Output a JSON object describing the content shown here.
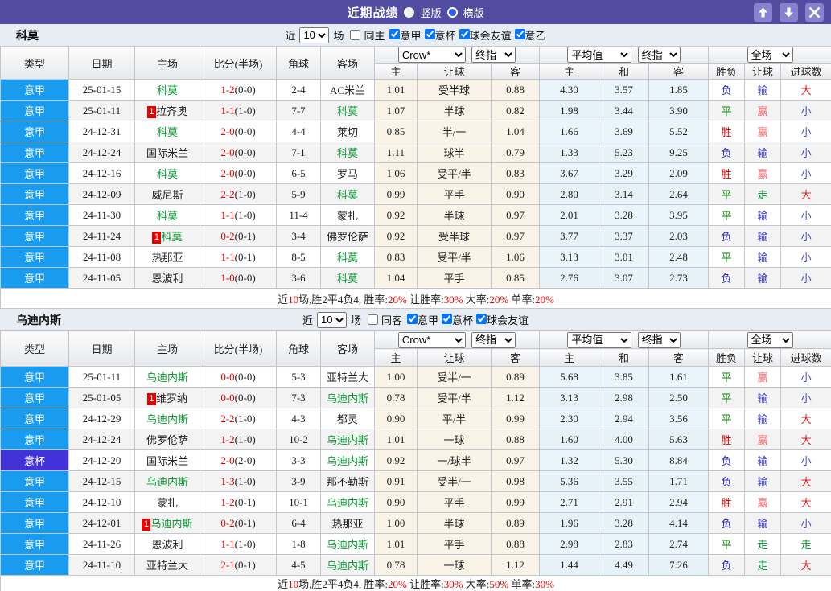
{
  "titlebar": {
    "title": "近期战绩",
    "layout_options": [
      {
        "label": "竖版",
        "selected": false
      },
      {
        "label": "横版",
        "selected": true
      }
    ],
    "button_icons": [
      "up-arrow-icon",
      "down-arrow-icon",
      "close-icon"
    ]
  },
  "colors": {
    "league_type": "#199CF0",
    "cup_type": "#4133D8",
    "team_green": "#0a9a32",
    "score_red": "#e60000",
    "titlebar_purple": "#524CA1",
    "value_colors": {
      "胜": "#d40000",
      "平": "#008000",
      "负": "#2626c9",
      "赢": "#f66666",
      "输": "#3535c9",
      "走": "#009030",
      "大": "#e22222",
      "小": "#4d4dde"
    }
  },
  "table_headers": {
    "base": [
      "类型",
      "日期",
      "主场",
      "比分(半场)",
      "角球",
      "客场"
    ],
    "sub": [
      "主",
      "让球",
      "客",
      "主",
      "和",
      "客",
      "胜负",
      "让球",
      "进球数"
    ]
  },
  "sections": [
    {
      "team": "科莫",
      "filter": {
        "recent": "近",
        "count": "10",
        "games": "场",
        "same": "同主",
        "same_checked": false,
        "leagues": [
          {
            "label": "意甲",
            "checked": true
          },
          {
            "label": "意杯",
            "checked": true
          },
          {
            "label": "球会友谊",
            "checked": true
          },
          {
            "label": "意乙",
            "checked": true
          }
        ]
      },
      "dropdowns": [
        "Crow*",
        "终指",
        "平均值",
        "终指",
        "全场"
      ],
      "rows": [
        {
          "type": "意甲",
          "cup": false,
          "date": "25-01-15",
          "home": "科莫",
          "home_green": true,
          "badge": "",
          "ft": "1-2",
          "ht": "(0-0)",
          "corner": "2-4",
          "away": "AC米兰",
          "away_green": false,
          "o1": "1.01",
          "o2": "受半球",
          "o3": "0.88",
          "a1": "4.30",
          "a2": "3.57",
          "a3": "1.85",
          "res": "负",
          "han": "输",
          "goal": "大"
        },
        {
          "type": "意甲",
          "cup": false,
          "date": "25-01-11",
          "home": "拉齐奥",
          "home_green": false,
          "badge": "1",
          "ft": "1-1",
          "ht": "(1-0)",
          "corner": "7-7",
          "away": "科莫",
          "away_green": true,
          "o1": "1.07",
          "o2": "半球",
          "o3": "0.82",
          "a1": "1.98",
          "a2": "3.44",
          "a3": "3.90",
          "res": "平",
          "han": "赢",
          "goal": "小"
        },
        {
          "type": "意甲",
          "cup": false,
          "date": "24-12-31",
          "home": "科莫",
          "home_green": true,
          "badge": "",
          "ft": "2-0",
          "ht": "(0-0)",
          "corner": "4-4",
          "away": "莱切",
          "away_green": false,
          "o1": "0.85",
          "o2": "半/一",
          "o3": "1.04",
          "a1": "1.66",
          "a2": "3.69",
          "a3": "5.52",
          "res": "胜",
          "han": "赢",
          "goal": "小"
        },
        {
          "type": "意甲",
          "cup": false,
          "date": "24-12-24",
          "home": "国际米兰",
          "home_green": false,
          "badge": "",
          "ft": "2-0",
          "ht": "(0-0)",
          "corner": "7-1",
          "away": "科莫",
          "away_green": true,
          "o1": "1.11",
          "o2": "球半",
          "o3": "0.79",
          "a1": "1.33",
          "a2": "5.23",
          "a3": "9.25",
          "res": "负",
          "han": "输",
          "goal": "小"
        },
        {
          "type": "意甲",
          "cup": false,
          "date": "24-12-16",
          "home": "科莫",
          "home_green": true,
          "badge": "",
          "ft": "2-0",
          "ht": "(0-0)",
          "corner": "6-5",
          "away": "罗马",
          "away_green": false,
          "o1": "1.06",
          "o2": "受平/半",
          "o3": "0.83",
          "a1": "3.67",
          "a2": "3.29",
          "a3": "2.09",
          "res": "胜",
          "han": "赢",
          "goal": "小"
        },
        {
          "type": "意甲",
          "cup": false,
          "date": "24-12-09",
          "home": "威尼斯",
          "home_green": false,
          "badge": "",
          "ft": "2-2",
          "ht": "(1-0)",
          "corner": "5-9",
          "away": "科莫",
          "away_green": true,
          "o1": "0.99",
          "o2": "平手",
          "o3": "0.90",
          "a1": "2.80",
          "a2": "3.14",
          "a3": "2.64",
          "res": "平",
          "han": "走",
          "goal": "大"
        },
        {
          "type": "意甲",
          "cup": false,
          "date": "24-11-30",
          "home": "科莫",
          "home_green": true,
          "badge": "",
          "ft": "1-1",
          "ht": "(1-0)",
          "corner": "11-4",
          "away": "蒙扎",
          "away_green": false,
          "o1": "0.92",
          "o2": "半球",
          "o3": "0.97",
          "a1": "2.01",
          "a2": "3.28",
          "a3": "3.95",
          "res": "平",
          "han": "输",
          "goal": "小"
        },
        {
          "type": "意甲",
          "cup": false,
          "date": "24-11-24",
          "home": "科莫",
          "home_green": true,
          "badge": "1",
          "ft": "0-2",
          "ht": "(0-1)",
          "corner": "3-4",
          "away": "佛罗伦萨",
          "away_green": false,
          "o1": "0.92",
          "o2": "受半球",
          "o3": "0.97",
          "a1": "3.77",
          "a2": "3.37",
          "a3": "2.03",
          "res": "负",
          "han": "输",
          "goal": "小"
        },
        {
          "type": "意甲",
          "cup": false,
          "date": "24-11-08",
          "home": "热那亚",
          "home_green": false,
          "badge": "",
          "ft": "1-1",
          "ht": "(0-1)",
          "corner": "8-5",
          "away": "科莫",
          "away_green": true,
          "o1": "0.83",
          "o2": "受平/半",
          "o3": "1.06",
          "a1": "3.13",
          "a2": "3.01",
          "a3": "2.48",
          "res": "平",
          "han": "输",
          "goal": "小"
        },
        {
          "type": "意甲",
          "cup": false,
          "date": "24-11-05",
          "home": "恩波利",
          "home_green": false,
          "badge": "",
          "ft": "1-0",
          "ht": "(0-0)",
          "corner": "3-6",
          "away": "科莫",
          "away_green": true,
          "o1": "1.04",
          "o2": "平手",
          "o3": "0.85",
          "a1": "2.76",
          "a2": "3.07",
          "a3": "2.73",
          "res": "负",
          "han": "输",
          "goal": "小"
        }
      ],
      "summary": [
        {
          "text": "近",
          "red": false
        },
        {
          "text": "10",
          "red": true
        },
        {
          "text": "场,胜2平4负4, 胜率:",
          "red": false
        },
        {
          "text": "20%",
          "red": true
        },
        {
          "text": " 让胜率:",
          "red": false
        },
        {
          "text": "30%",
          "red": true
        },
        {
          "text": " 大率:",
          "red": false
        },
        {
          "text": "20%",
          "red": true
        },
        {
          "text": " 单率:",
          "red": false
        },
        {
          "text": "20%",
          "red": true
        }
      ]
    },
    {
      "team": "乌迪内斯",
      "filter": {
        "recent": "近",
        "count": "10",
        "games": "场",
        "same": "同客",
        "same_checked": false,
        "leagues": [
          {
            "label": "意甲",
            "checked": true
          },
          {
            "label": "意杯",
            "checked": true
          },
          {
            "label": "球会友谊",
            "checked": true
          }
        ]
      },
      "dropdowns": [
        "Crow*",
        "终指",
        "平均值",
        "终指",
        "全场"
      ],
      "rows": [
        {
          "type": "意甲",
          "cup": false,
          "date": "25-01-11",
          "home": "乌迪内斯",
          "home_green": true,
          "badge": "",
          "ft": "0-0",
          "ht": "(0-0)",
          "corner": "5-3",
          "away": "亚特兰大",
          "away_green": false,
          "o1": "1.00",
          "o2": "受半/一",
          "o3": "0.89",
          "a1": "5.68",
          "a2": "3.85",
          "a3": "1.61",
          "res": "平",
          "han": "赢",
          "goal": "小"
        },
        {
          "type": "意甲",
          "cup": false,
          "date": "25-01-05",
          "home": "维罗纳",
          "home_green": false,
          "badge": "1",
          "ft": "0-0",
          "ht": "(0-0)",
          "corner": "7-3",
          "away": "乌迪内斯",
          "away_green": true,
          "o1": "0.78",
          "o2": "受平/半",
          "o3": "1.12",
          "a1": "3.13",
          "a2": "2.98",
          "a3": "2.50",
          "res": "平",
          "han": "输",
          "goal": "小"
        },
        {
          "type": "意甲",
          "cup": false,
          "date": "24-12-29",
          "home": "乌迪内斯",
          "home_green": true,
          "badge": "",
          "ft": "2-2",
          "ht": "(1-0)",
          "corner": "4-3",
          "away": "都灵",
          "away_green": false,
          "o1": "0.90",
          "o2": "平/半",
          "o3": "0.99",
          "a1": "2.30",
          "a2": "2.94",
          "a3": "3.56",
          "res": "平",
          "han": "输",
          "goal": "大"
        },
        {
          "type": "意甲",
          "cup": false,
          "date": "24-12-24",
          "home": "佛罗伦萨",
          "home_green": false,
          "badge": "",
          "ft": "1-2",
          "ht": "(1-0)",
          "corner": "10-2",
          "away": "乌迪内斯",
          "away_green": true,
          "o1": "1.01",
          "o2": "一球",
          "o3": "0.88",
          "a1": "1.60",
          "a2": "4.00",
          "a3": "5.63",
          "res": "胜",
          "han": "赢",
          "goal": "大"
        },
        {
          "type": "意杯",
          "cup": true,
          "date": "24-12-20",
          "home": "国际米兰",
          "home_green": false,
          "badge": "",
          "ft": "2-0",
          "ht": "(2-0)",
          "corner": "3-3",
          "away": "乌迪内斯",
          "away_green": true,
          "o1": "0.92",
          "o2": "一/球半",
          "o3": "0.97",
          "a1": "1.32",
          "a2": "5.30",
          "a3": "8.84",
          "res": "负",
          "han": "输",
          "goal": "小"
        },
        {
          "type": "意甲",
          "cup": false,
          "date": "24-12-15",
          "home": "乌迪内斯",
          "home_green": true,
          "badge": "",
          "ft": "1-3",
          "ht": "(1-0)",
          "corner": "3-9",
          "away": "那不勒斯",
          "away_green": false,
          "o1": "0.91",
          "o2": "受半/一",
          "o3": "0.98",
          "a1": "5.36",
          "a2": "3.55",
          "a3": "1.71",
          "res": "负",
          "han": "输",
          "goal": "大"
        },
        {
          "type": "意甲",
          "cup": false,
          "date": "24-12-10",
          "home": "蒙扎",
          "home_green": false,
          "badge": "",
          "ft": "1-2",
          "ht": "(0-1)",
          "corner": "10-1",
          "away": "乌迪内斯",
          "away_green": true,
          "o1": "0.90",
          "o2": "平手",
          "o3": "0.99",
          "a1": "2.71",
          "a2": "2.91",
          "a3": "2.94",
          "res": "胜",
          "han": "赢",
          "goal": "大"
        },
        {
          "type": "意甲",
          "cup": false,
          "date": "24-12-01",
          "home": "乌迪内斯",
          "home_green": true,
          "badge": "1",
          "ft": "0-2",
          "ht": "(0-1)",
          "corner": "6-4",
          "away": "热那亚",
          "away_green": false,
          "o1": "1.00",
          "o2": "半球",
          "o3": "0.89",
          "a1": "1.96",
          "a2": "3.28",
          "a3": "4.14",
          "res": "负",
          "han": "输",
          "goal": "小"
        },
        {
          "type": "意甲",
          "cup": false,
          "date": "24-11-26",
          "home": "恩波利",
          "home_green": false,
          "badge": "",
          "ft": "1-1",
          "ht": "(1-0)",
          "corner": "1-8",
          "away": "乌迪内斯",
          "away_green": true,
          "o1": "1.01",
          "o2": "平手",
          "o3": "0.88",
          "a1": "2.98",
          "a2": "2.83",
          "a3": "2.74",
          "res": "平",
          "han": "走",
          "goal": "走"
        },
        {
          "type": "意甲",
          "cup": false,
          "date": "24-11-10",
          "home": "亚特兰大",
          "home_green": false,
          "badge": "",
          "ft": "2-1",
          "ht": "(0-1)",
          "corner": "4-5",
          "away": "乌迪内斯",
          "away_green": true,
          "o1": "0.78",
          "o2": "一球",
          "o3": "1.12",
          "a1": "1.44",
          "a2": "4.49",
          "a3": "7.26",
          "res": "负",
          "han": "走",
          "goal": "大"
        }
      ],
      "summary": [
        {
          "text": "近",
          "red": false
        },
        {
          "text": "10",
          "red": true
        },
        {
          "text": "场,胜2平4负4, 胜率:",
          "red": false
        },
        {
          "text": "20%",
          "red": true
        },
        {
          "text": " 让胜率:",
          "red": false
        },
        {
          "text": "30%",
          "red": true
        },
        {
          "text": " 大率:",
          "red": false
        },
        {
          "text": "50%",
          "red": true
        },
        {
          "text": " 单率:",
          "red": false
        },
        {
          "text": "30%",
          "red": true
        }
      ]
    }
  ]
}
